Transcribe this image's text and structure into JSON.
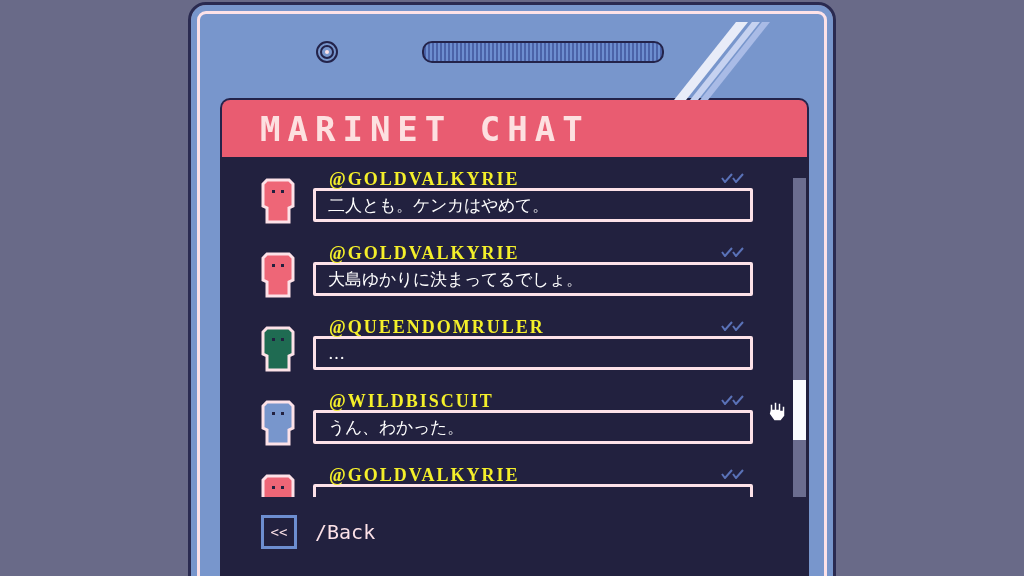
{
  "app": {
    "title": "MARINET CHAT"
  },
  "messages": [
    {
      "username": "@GOLDVALKYRIE",
      "text": "二人とも。ケンカはやめて。",
      "color": "#ee6677"
    },
    {
      "username": "@GOLDVALKYRIE",
      "text": "大島ゆかりに決まってるでしょ。",
      "color": "#ee6677"
    },
    {
      "username": "@QUEENDOMRULER",
      "text": "…",
      "color": "#1f6b52"
    },
    {
      "username": "@WILDBISCUIT",
      "text": "うん、わかった。",
      "color": "#7896cc"
    },
    {
      "username": "@GOLDVALKYRIE",
      "color": "#ee6677"
    }
  ],
  "back": {
    "icon": "<<",
    "label": "/Back"
  }
}
